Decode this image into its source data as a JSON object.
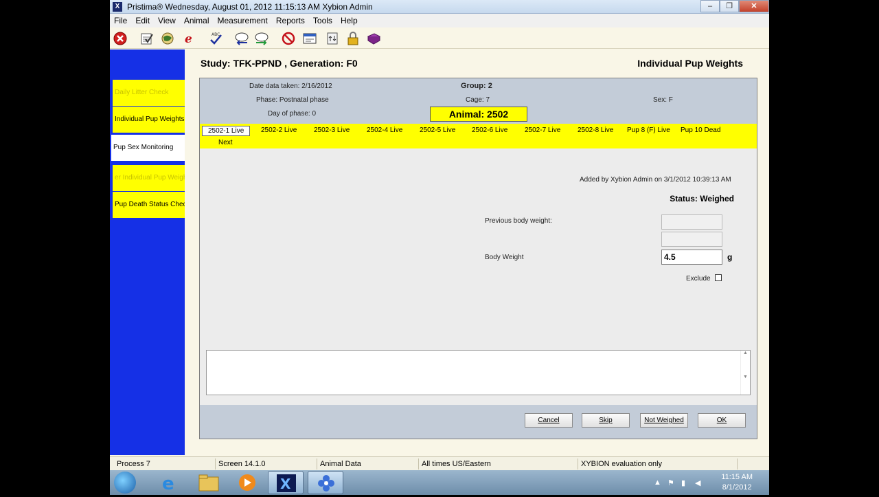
{
  "window": {
    "title": "Pristima®  Wednesday, August 01, 2012 11:15:13 AM Xybion Admin",
    "controls": [
      "–",
      "❐",
      "✕"
    ]
  },
  "menu": [
    "File",
    "Edit",
    "View",
    "Animal",
    "Measurement",
    "Reports",
    "Tools",
    "Help"
  ],
  "toolbar_icons": [
    "cancel-icon",
    "notepad-check-icon",
    "globe-icon",
    "e-icon",
    "spellcheck-icon",
    "cloud-back-icon",
    "cloud-forward-icon",
    "no-sign-icon",
    "form-icon",
    "exchange-icon",
    "lock-icon",
    "book-icon"
  ],
  "sidebar": {
    "items": [
      {
        "label": "Daily Litter Check"
      },
      {
        "label": "Individual Pup Weights"
      },
      {
        "label": "Pup Sex Monitoring"
      },
      {
        "label": "er Individual Pup Weigh"
      },
      {
        "label": "Pup Death Status Chec"
      }
    ]
  },
  "header": {
    "study": "Study: TFK-PPND , Generation: F0",
    "form_title": "Individual Pup Weights"
  },
  "info": {
    "date_taken": "Date data taken: 2/16/2012",
    "phase": "Phase: Postnatal phase",
    "day_of_phase": "Day of phase: 0",
    "group": "Group: 2",
    "cage": "Cage: 7",
    "sex": "Sex: F",
    "animal": "Animal: 2502"
  },
  "pups": [
    "2502-1 Live",
    "2502-2 Live",
    "2502-3 Live",
    "2502-4 Live",
    "2502-5 Live",
    "2502-6 Live",
    "2502-7 Live",
    "2502-8 Live",
    "Pup 8 (F) Live",
    "Pup 10 Dead"
  ],
  "next_label": "Next",
  "form": {
    "added_by": "Added by Xybion Admin on 3/1/2012 10:39:13 AM",
    "status": "Status: Weighed",
    "previous_weight_label": "Previous body weight:",
    "previous_weight_value": "",
    "body_weight_label": "Body Weight",
    "body_weight_value": "4.5",
    "unit": "g",
    "exclude_label": "Exclude",
    "exclude_checked": false
  },
  "buttons": {
    "cancel": "Cancel",
    "skip": "Skip",
    "not_weighed": "Not Weighed",
    "ok": "OK"
  },
  "statusbar": {
    "process": "Process 7",
    "screen": "Screen 14.1.0",
    "module": "Animal Data",
    "timezone": "All times US/Eastern",
    "license": "XYBION evaluation only"
  },
  "taskbar": {
    "time": "11:15 AM",
    "date": "8/1/2012",
    "apps": [
      "start-orb-icon",
      "internet-explorer-icon",
      "folder-icon",
      "media-player-icon",
      "pristima-icon",
      "flower-app-icon"
    ]
  },
  "colors": {
    "sidebar": "#1530e6",
    "highlight": "#ffff00",
    "panel_head": "#c3ccd8",
    "background": "#f9f6e7"
  }
}
